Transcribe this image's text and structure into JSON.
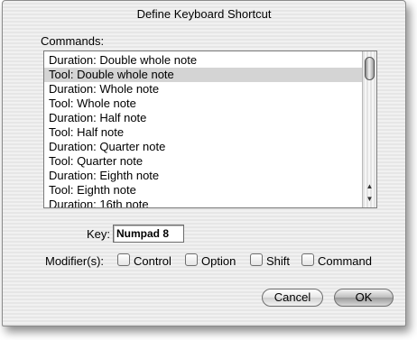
{
  "dialog": {
    "title": "Define Keyboard Shortcut"
  },
  "commands": {
    "label": "Commands:",
    "items": [
      "Duration: Double whole note",
      "Tool: Double whole note",
      "Duration: Whole note",
      "Tool: Whole note",
      "Duration: Half note",
      "Tool: Half note",
      "Duration: Quarter note",
      "Tool: Quarter note",
      "Duration: Eighth note",
      "Tool: Eighth note",
      "Duration: 16th note"
    ],
    "selected_index": 1
  },
  "scrollbar": {
    "up_icon": "up-arrow-icon",
    "down_icon": "down-arrow-icon"
  },
  "key": {
    "label": "Key:",
    "value": "Numpad 8"
  },
  "modifiers": {
    "label": "Modifier(s):",
    "options": [
      {
        "label": "Control",
        "checked": false
      },
      {
        "label": "Option",
        "checked": false
      },
      {
        "label": "Shift",
        "checked": false
      },
      {
        "label": "Command",
        "checked": false
      }
    ]
  },
  "buttons": {
    "cancel": "Cancel",
    "ok": "OK"
  }
}
